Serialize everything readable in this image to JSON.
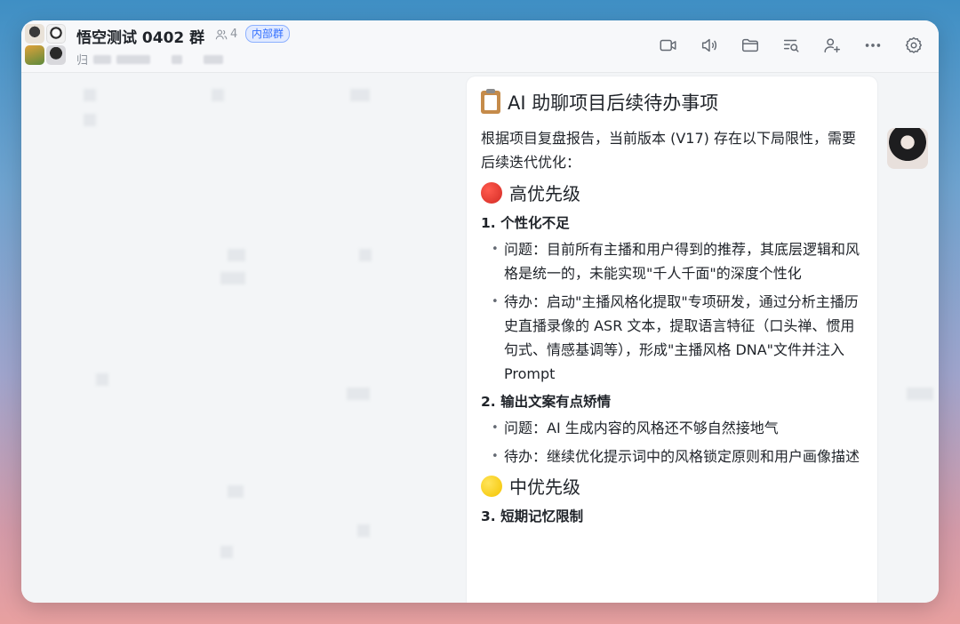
{
  "header": {
    "title": "悟空测试 0402 群",
    "member_count": "4",
    "tag": "内部群",
    "subtitle_char": "归"
  },
  "toolbar": {
    "icons": [
      "video-icon",
      "voice-icon",
      "folder-icon",
      "search-list-icon",
      "add-member-icon",
      "more-icon",
      "settings-icon"
    ]
  },
  "message": {
    "title": "AI 助聊项目后续待办事项",
    "intro": "根据项目复盘报告，当前版本 (V17) 存在以下局限性，需要后续迭代优化：",
    "high_priority": "高优先级",
    "item1": {
      "title": "1. 个性化不足",
      "problem": "问题：目前所有主播和用户得到的推荐，其底层逻辑和风格是统一的，未能实现\"千人千面\"的深度个性化",
      "todo": "待办：启动\"主播风格化提取\"专项研发，通过分析主播历史直播录像的 ASR 文本，提取语言特征（口头禅、惯用句式、情感基调等），形成\"主播风格 DNA\"文件并注入 Prompt"
    },
    "item2": {
      "title": "2. 输出文案有点矫情",
      "problem": "问题：AI 生成内容的风格还不够自然接地气",
      "todo": "待办：继续优化提示词中的风格锁定原则和用户画像描述"
    },
    "mid_priority": "中优先级",
    "item3": {
      "title": "3. 短期记忆限制"
    }
  },
  "colors": {
    "accent": "#3370ff",
    "window_bg": "#f3f5f7",
    "card_bg": "#ffffff",
    "text": "#1f2329"
  }
}
